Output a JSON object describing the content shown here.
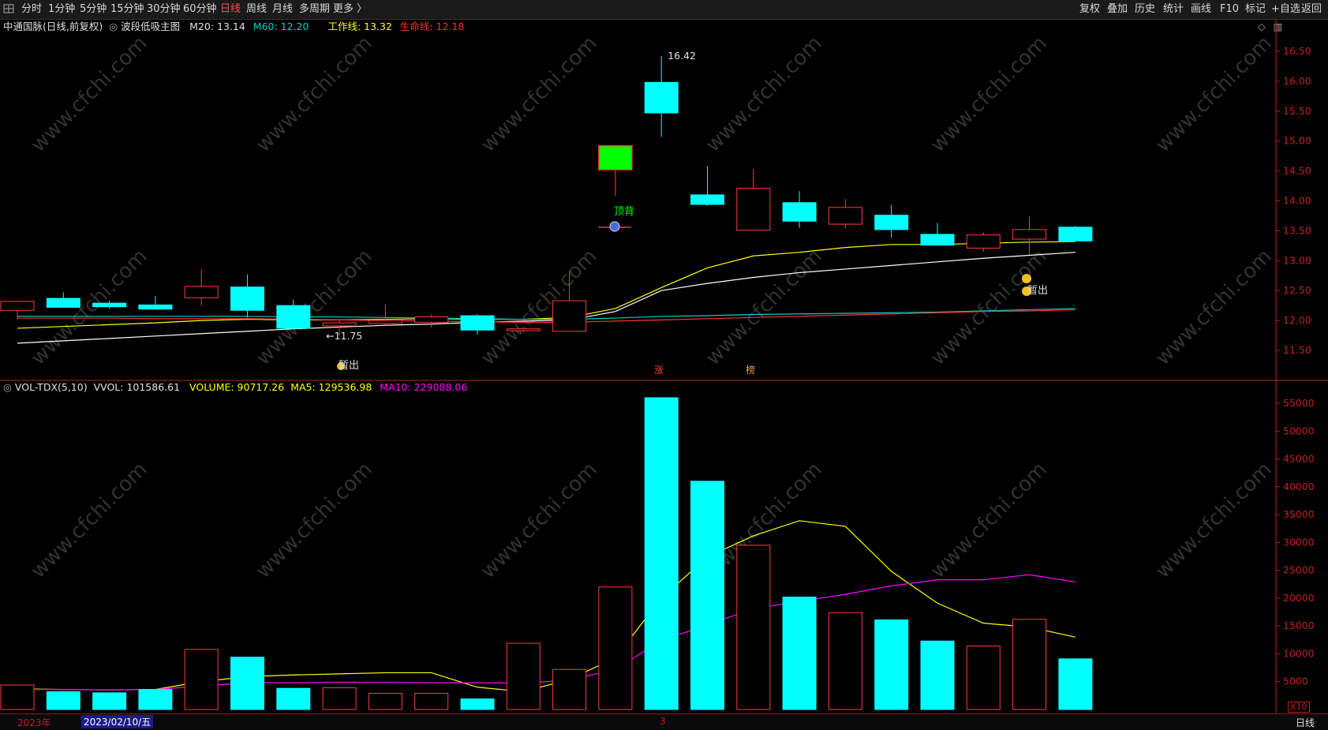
{
  "toolbar": {
    "menu_icon": "grid-menu-icon",
    "periods": [
      "分时",
      "1分钟",
      "5分钟",
      "15分钟",
      "30分钟",
      "60分钟",
      "日线",
      "周线",
      "月线",
      "多周期",
      "更多 〉"
    ],
    "active_period": "日线",
    "right_buttons": [
      "复权",
      "叠加",
      "历史",
      "统计",
      "画线",
      "F10",
      "标记",
      "+自选",
      "返回"
    ]
  },
  "header": {
    "stock": "中通国脉(日线,前复权)",
    "indicator": "波段低吸主图",
    "m20": "M20: 13.14",
    "m60": "M60: 12.20",
    "work_line": "工作线: 13.32",
    "life_line": "生命线: 12.18"
  },
  "vol_header": {
    "name": "VOL-TDX(5,10)",
    "vvol": "VVOL: 101586.61",
    "volume": "VOLUME: 90717.26",
    "ma5": "MA5: 129536.98",
    "ma10": "MA10: 229088.06"
  },
  "colors": {
    "up": "#ff3b3b",
    "down": "#00ffff",
    "limit_up": "#00ff00",
    "work_line": "#ffff00",
    "m20": "#ffffff",
    "m60": "#00cccc",
    "life_line": "#ff3030",
    "ma10": "#ff00ff",
    "axis": "#c02020",
    "watermark": "#5a5a5a"
  },
  "chart_data": [
    {
      "type": "candlestick",
      "title": "中通国脉(日线,前复权)",
      "ylim": [
        11.25,
        16.75
      ],
      "y_ticks": [
        "11.50",
        "12.00",
        "12.50",
        "13.00",
        "13.50",
        "14.00",
        "14.50",
        "15.00",
        "15.50",
        "16.00",
        "16.50"
      ],
      "candles": [
        {
          "o": 12.17,
          "h": 12.33,
          "l": 12.02,
          "c": 12.32
        },
        {
          "o": 12.37,
          "h": 12.47,
          "l": 12.25,
          "c": 12.22
        },
        {
          "o": 12.29,
          "h": 12.33,
          "l": 12.2,
          "c": 12.23
        },
        {
          "o": 12.26,
          "h": 12.41,
          "l": 12.18,
          "c": 12.19
        },
        {
          "o": 12.38,
          "h": 12.85,
          "l": 12.25,
          "c": 12.57
        },
        {
          "o": 12.56,
          "h": 12.77,
          "l": 12.05,
          "c": 12.17
        },
        {
          "o": 12.25,
          "h": 12.35,
          "l": 11.86,
          "c": 11.87
        },
        {
          "o": 11.91,
          "h": 12.01,
          "l": 11.75,
          "c": 11.96
        },
        {
          "o": 11.95,
          "h": 12.27,
          "l": 11.93,
          "c": 12.0
        },
        {
          "o": 11.97,
          "h": 12.1,
          "l": 11.88,
          "c": 12.06
        },
        {
          "o": 12.08,
          "h": 12.1,
          "l": 11.76,
          "c": 11.84
        },
        {
          "o": 11.83,
          "h": 11.89,
          "l": 11.8,
          "c": 11.86
        },
        {
          "o": 11.82,
          "h": 12.83,
          "l": 11.82,
          "c": 12.33
        },
        {
          "o": 14.52,
          "h": 14.92,
          "l": 14.08,
          "c": 14.92
        },
        {
          "o": 15.98,
          "h": 16.42,
          "l": 15.07,
          "c": 15.47
        },
        {
          "o": 14.1,
          "h": 14.58,
          "l": 13.92,
          "c": 13.94
        },
        {
          "o": 13.51,
          "h": 14.53,
          "l": 13.51,
          "c": 14.21
        },
        {
          "o": 13.97,
          "h": 14.16,
          "l": 13.55,
          "c": 13.66
        },
        {
          "o": 13.61,
          "h": 14.03,
          "l": 13.54,
          "c": 13.89
        },
        {
          "o": 13.76,
          "h": 13.93,
          "l": 13.38,
          "c": 13.52
        },
        {
          "o": 13.44,
          "h": 13.63,
          "l": 13.27,
          "c": 13.26
        },
        {
          "o": 13.21,
          "h": 13.47,
          "l": 13.15,
          "c": 13.43
        },
        {
          "o": 13.36,
          "h": 13.74,
          "l": 13.1,
          "c": 13.52
        },
        {
          "o": 13.56,
          "h": 13.58,
          "l": 13.32,
          "c": 13.33
        }
      ],
      "series": [
        {
          "name": "M20",
          "color": "#ffffff",
          "values": [
            11.62,
            11.66,
            11.7,
            11.74,
            11.78,
            11.82,
            11.86,
            11.89,
            11.92,
            11.94,
            11.97,
            11.99,
            12.01,
            12.15,
            12.5,
            12.62,
            12.72,
            12.8,
            12.86,
            12.92,
            12.98,
            13.04,
            13.09,
            13.14
          ]
        },
        {
          "name": "工作线",
          "color": "#ffff00",
          "values": [
            11.87,
            11.9,
            11.93,
            11.96,
            12.0,
            12.02,
            12.01,
            12.01,
            12.02,
            12.03,
            12.02,
            12.02,
            12.05,
            12.2,
            12.55,
            12.88,
            13.08,
            13.14,
            13.22,
            13.27,
            13.27,
            13.29,
            13.31,
            13.32
          ]
        },
        {
          "name": "M60",
          "color": "#00cccc",
          "values": [
            12.07,
            12.07,
            12.07,
            12.07,
            12.07,
            12.07,
            12.06,
            12.06,
            12.05,
            12.04,
            12.03,
            12.02,
            12.02,
            12.04,
            12.07,
            12.08,
            12.1,
            12.11,
            12.12,
            12.13,
            12.14,
            12.16,
            12.18,
            12.2
          ]
        },
        {
          "name": "生命线",
          "color": "#ff3030",
          "values": [
            12.04,
            12.04,
            12.04,
            12.03,
            12.03,
            12.03,
            12.02,
            12.01,
            12.0,
            11.99,
            11.98,
            11.97,
            11.97,
            11.99,
            12.01,
            12.03,
            12.05,
            12.07,
            12.09,
            12.11,
            12.13,
            12.15,
            12.16,
            12.18
          ]
        }
      ],
      "annotations": {
        "high_label": "16.42",
        "low_label": "←11.75",
        "top_divergence": "顶背",
        "sell_left": "暂出",
        "sell_right": "暂出",
        "limit_up_mark": "涨",
        "list_mark": "榜"
      }
    },
    {
      "type": "bar",
      "title": "VOL-TDX(5,10)",
      "ylim": [
        0,
        58000
      ],
      "y_ticks": [
        "5000",
        "10000",
        "15000",
        "20000",
        "25000",
        "30000",
        "35000",
        "40000",
        "45000",
        "50000",
        "55000"
      ],
      "values": [
        4400,
        3200,
        3000,
        3600,
        10800,
        9400,
        3800,
        3900,
        2900,
        2900,
        1900,
        11900,
        7200,
        22000,
        56000,
        41000,
        29500,
        20200,
        17400,
        16100,
        12300,
        11400,
        16200,
        9100
      ],
      "series": [
        {
          "name": "MA5",
          "color": "#ffff00",
          "values": [
            3700,
            3600,
            3500,
            3600,
            5000,
            5900,
            6200,
            6400,
            6600,
            6600,
            4000,
            3200,
            5400,
            9300,
            20000,
            27400,
            31200,
            33900,
            32900,
            24800,
            19100,
            15500,
            14800,
            13000
          ]
        },
        {
          "name": "MA10",
          "color": "#ff00ff",
          "values": [
            3600,
            3600,
            3500,
            3600,
            4200,
            4800,
            4800,
            4900,
            4900,
            4800,
            4800,
            4700,
            5300,
            7200,
            12400,
            15200,
            18100,
            19400,
            20700,
            22200,
            23300,
            23300,
            24200,
            22900
          ]
        }
      ]
    }
  ],
  "footer": {
    "year": "2023年",
    "date": "2023/02/10/五",
    "month_mark": "3",
    "period": "日线",
    "scale": "X10"
  },
  "watermark": "www.cfchi.com"
}
